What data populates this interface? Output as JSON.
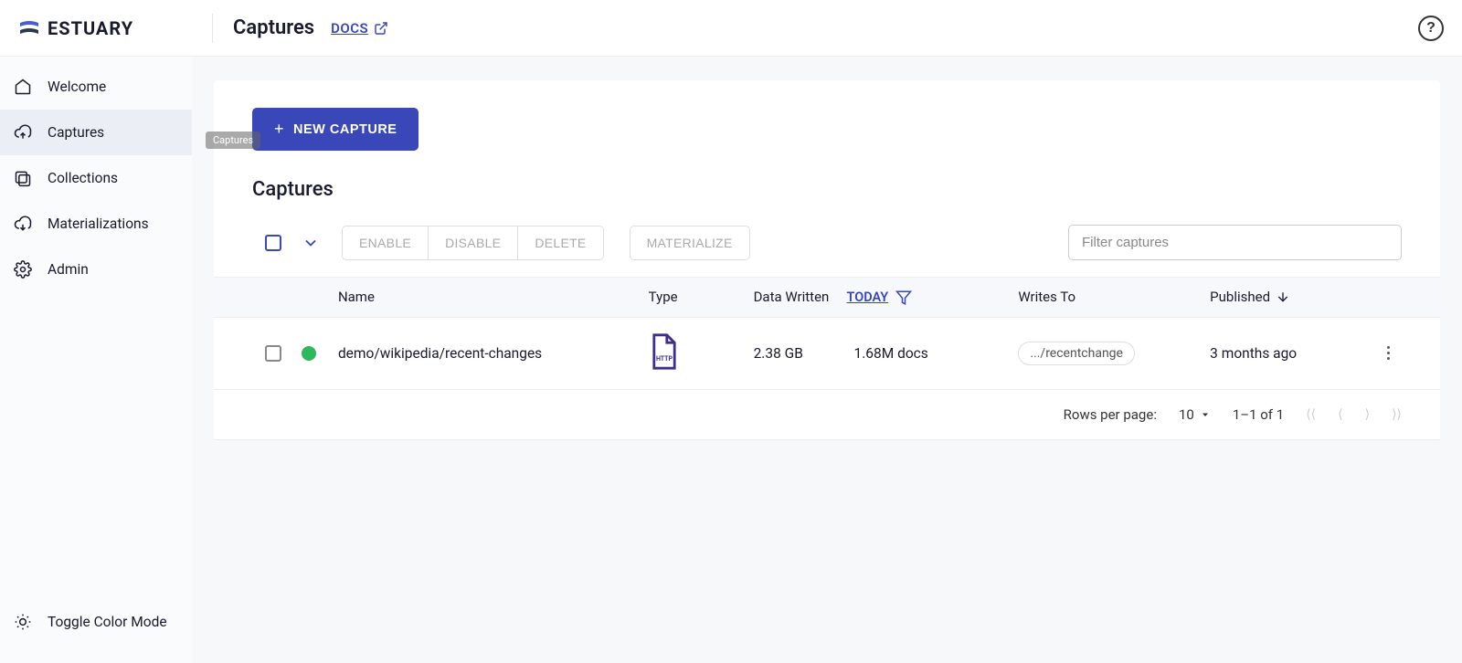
{
  "brand": "ESTUARY",
  "header": {
    "title": "Captures",
    "docs_label": "DOCS"
  },
  "sidebar": {
    "items": [
      {
        "label": "Welcome"
      },
      {
        "label": "Captures"
      },
      {
        "label": "Collections"
      },
      {
        "label": "Materializations"
      },
      {
        "label": "Admin"
      }
    ],
    "toggle_label": "Toggle Color Mode",
    "tooltip": "Captures"
  },
  "main": {
    "new_button": "NEW CAPTURE",
    "section_title": "Captures",
    "toolbar": {
      "enable": "ENABLE",
      "disable": "DISABLE",
      "delete": "DELETE",
      "materialize": "MATERIALIZE",
      "filter_placeholder": "Filter captures"
    },
    "columns": {
      "name": "Name",
      "type": "Type",
      "data_written": "Data Written",
      "today": "TODAY",
      "writes_to": "Writes To",
      "published": "Published"
    },
    "rows": [
      {
        "name": "demo/wikipedia/recent-changes",
        "data_written": "2.38 GB",
        "docs": "1.68M docs",
        "writes_to": ".../recentchange",
        "published": "3 months ago"
      }
    ],
    "pagination": {
      "rows_label": "Rows per page:",
      "rows_value": "10",
      "range": "1–1 of 1"
    }
  }
}
